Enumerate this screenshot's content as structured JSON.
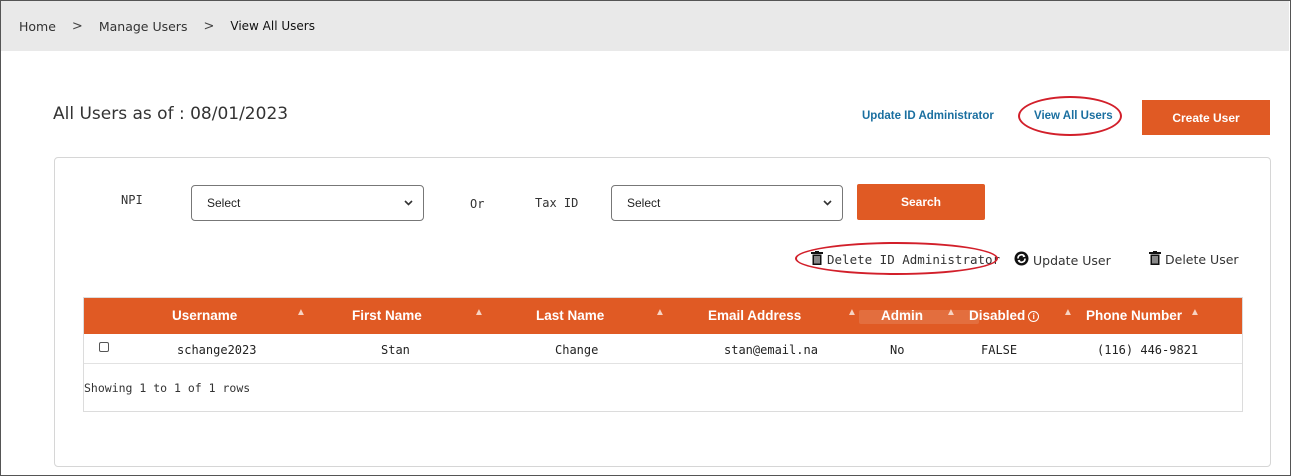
{
  "breadcrumb": {
    "home": "Home",
    "sep1": ">",
    "manage": "Manage Users",
    "sep2": ">",
    "current": "View All Users"
  },
  "page": {
    "title": "All Users as of : 08/01/2023"
  },
  "top_links": {
    "update_admin": "Update ID Administrator",
    "view_all": "View All Users",
    "create_user": "Create User"
  },
  "filters": {
    "npi_label": "NPI",
    "npi_value": "Select",
    "or_label": "Or",
    "tax_label": "Tax ID",
    "tax_value": "Select",
    "search_label": "Search"
  },
  "actions": {
    "delete_admin": "Delete ID Administrator",
    "update_user": "Update User",
    "delete_user": "Delete User"
  },
  "table": {
    "headers": [
      "Username",
      "First Name",
      "Last Name",
      "Email Address",
      "Admin",
      "Disabled",
      "Phone Number"
    ],
    "rows": [
      {
        "username": "schange2023",
        "first": "Stan",
        "last": "Change",
        "email": "stan@email.na",
        "admin": "No",
        "disabled": "FALSE",
        "phone": "(116) 446-9821"
      }
    ],
    "footer": "Showing 1 to 1 of 1 rows"
  },
  "colors": {
    "accent": "#e05a24",
    "link": "#1a6fa0",
    "highlight_circle": "#d21f2a"
  }
}
